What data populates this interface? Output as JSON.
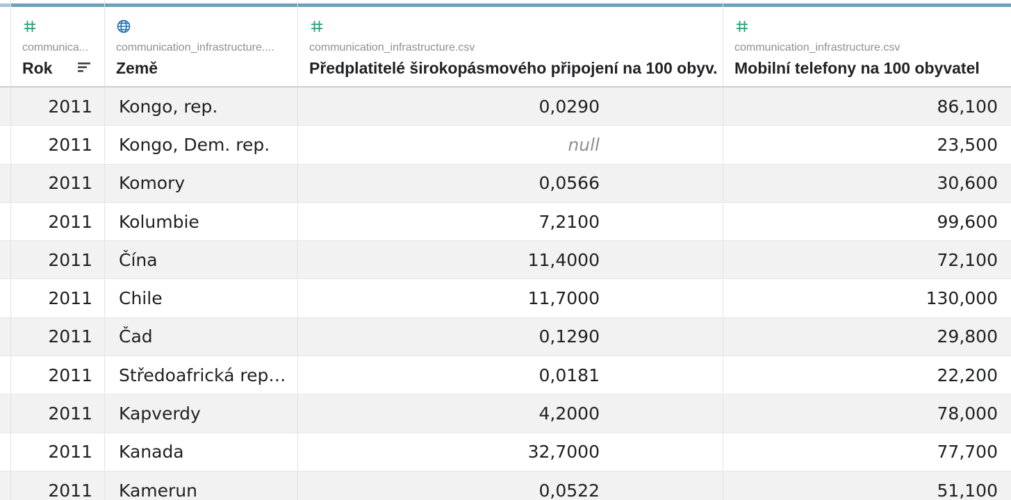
{
  "colors": {
    "accent_bar": "#6e9fbd",
    "numeric_icon": "#2e9e7a",
    "geo_icon": "#1f6fb2",
    "row_alt": "#f2f2f2"
  },
  "columns": [
    {
      "type_icon": "hash-icon",
      "source": "communica...",
      "title": "Rok",
      "sort_icon": "sort-descending-icon"
    },
    {
      "type_icon": "globe-icon",
      "source": "communication_infrastructure....",
      "title": "Země"
    },
    {
      "type_icon": "hash-icon",
      "source": "communication_infrastructure.csv",
      "title": "Předplatitelé širokopásmového připojení na 100 obyv."
    },
    {
      "type_icon": "hash-icon",
      "source": "communication_infrastructure.csv",
      "title": "Mobilní telefony na 100 obyvatel"
    }
  ],
  "rows": [
    {
      "rok": "2011",
      "zeme": "Kongo, rep.",
      "broadband": "0,0290",
      "mobile": "86,100"
    },
    {
      "rok": "2011",
      "zeme": "Kongo, Dem. rep.",
      "broadband": "null",
      "mobile": "23,500"
    },
    {
      "rok": "2011",
      "zeme": "Komory",
      "broadband": "0,0566",
      "mobile": "30,600"
    },
    {
      "rok": "2011",
      "zeme": "Kolumbie",
      "broadband": "7,2100",
      "mobile": "99,600"
    },
    {
      "rok": "2011",
      "zeme": "Čína",
      "broadband": "11,4000",
      "mobile": "72,100"
    },
    {
      "rok": "2011",
      "zeme": "Chile",
      "broadband": "11,7000",
      "mobile": "130,000"
    },
    {
      "rok": "2011",
      "zeme": "Čad",
      "broadband": "0,1290",
      "mobile": "29,800"
    },
    {
      "rok": "2011",
      "zeme": "Středoafrická repu…",
      "broadband": "0,0181",
      "mobile": "22,200"
    },
    {
      "rok": "2011",
      "zeme": "Kapverdy",
      "broadband": "4,2000",
      "mobile": "78,000"
    },
    {
      "rok": "2011",
      "zeme": "Kanada",
      "broadband": "32,7000",
      "mobile": "77,700"
    },
    {
      "rok": "2011",
      "zeme": "Kamerun",
      "broadband": "0,0522",
      "mobile": "51,100"
    }
  ]
}
